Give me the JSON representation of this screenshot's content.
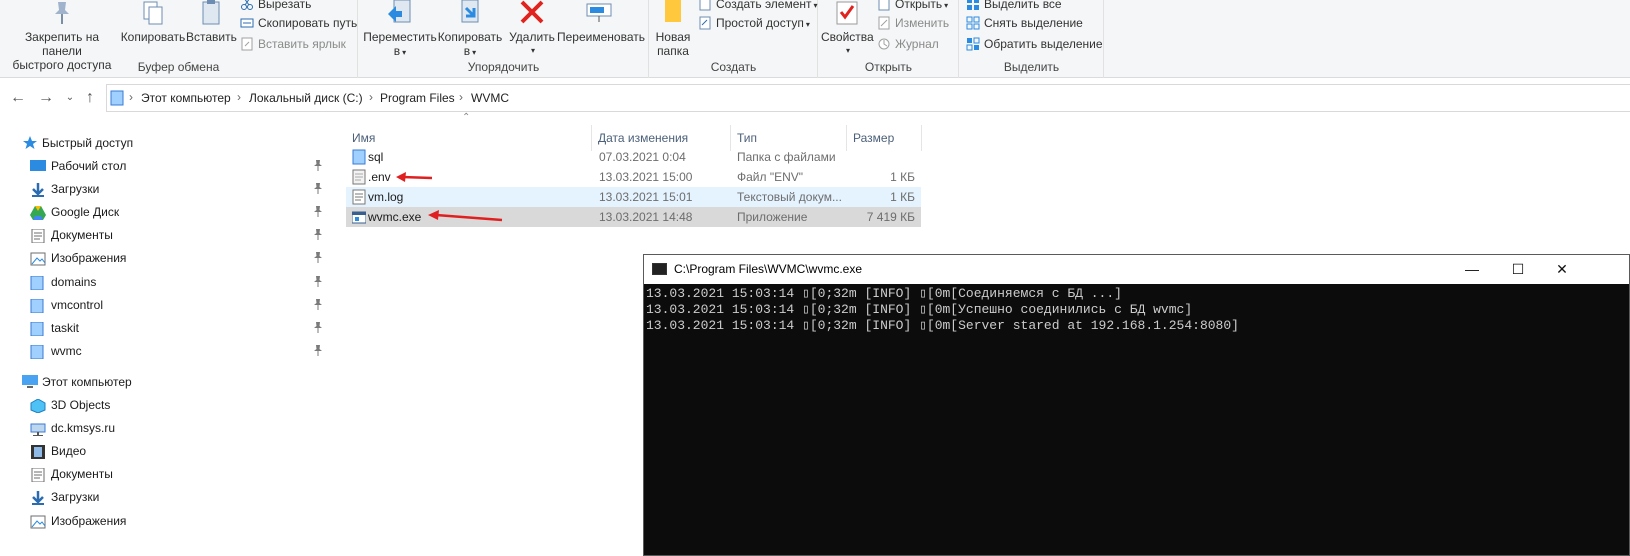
{
  "ribbon": {
    "clipboard": {
      "pin_quick_access": "Закрепить на панели\nбыстрого доступа",
      "pin_line1": "Закрепить на панели",
      "pin_line2": "быстрого доступа",
      "copy": "Копировать",
      "paste": "Вставить",
      "cut": "Вырезать",
      "copy_path": "Скопировать путь",
      "paste_shortcut": "Вставить ярлык",
      "group_label": "Буфер обмена"
    },
    "organize": {
      "move_line1": "Переместить",
      "move_line2": "в",
      "copy_line1": "Копировать",
      "copy_line2": "в",
      "delete": "Удалить",
      "rename": "Переименовать",
      "group_label": "Упорядочить"
    },
    "create": {
      "new_folder_line1": "Новая",
      "new_folder_line2": "папка",
      "new_item": "Создать элемент",
      "easy_access": "Простой доступ",
      "group_label": "Создать"
    },
    "open": {
      "properties": "Свойства",
      "open": "Открыть",
      "edit": "Изменить",
      "history": "Журнал",
      "group_label": "Открыть"
    },
    "select": {
      "select_all": "Выделить все",
      "select_none": "Снять выделение",
      "invert": "Обратить выделение",
      "group_label": "Выделить"
    }
  },
  "address": {
    "crumbs": [
      "Этот компьютер",
      "Локальный диск (C:)",
      "Program Files",
      "WVMC"
    ]
  },
  "nav": {
    "quick_access": "Быстрый доступ",
    "quick_items": [
      "Рабочий стол",
      "Загрузки",
      "Google Диск",
      "Документы",
      "Изображения",
      "domains",
      "vmcontrol",
      "taskit",
      "wvmc"
    ],
    "this_pc": "Этот компьютер",
    "pc_items": [
      "3D Objects",
      "dc.kmsys.ru",
      "Видео",
      "Документы",
      "Загрузки",
      "Изображения"
    ]
  },
  "files": {
    "columns": [
      "Имя",
      "Дата изменения",
      "Тип",
      "Размер"
    ],
    "rows": [
      {
        "name": "sql",
        "date": "07.03.2021 0:04",
        "type": "Папка с файлами",
        "size": ""
      },
      {
        "name": ".env",
        "date": "13.03.2021 15:00",
        "type": "Файл \"ENV\"",
        "size": "1 КБ"
      },
      {
        "name": "vm.log",
        "date": "13.03.2021 15:01",
        "type": "Текстовый докум...",
        "size": "1 КБ"
      },
      {
        "name": "wvmc.exe",
        "date": "13.03.2021 14:48",
        "type": "Приложение",
        "size": "7 419 КБ"
      }
    ]
  },
  "console": {
    "title": "C:\\Program Files\\WVMC\\wvmc.exe",
    "lines": [
      "13.03.2021 15:03:14 ▯[0;32m [INFO] ▯[0m[Соединяемся с БД ...]",
      "13.03.2021 15:03:14 ▯[0;32m [INFO] ▯[0m[Успешно соединились с БД wvmc]",
      "13.03.2021 15:03:14 ▯[0;32m [INFO] ▯[0m[Server stared at 192.168.1.254:8080]"
    ],
    "minimize": "—",
    "maximize": "☐",
    "close": "✕"
  },
  "colors": {
    "selected_row": "#cce8ff",
    "hover_row": "#e5f3ff",
    "annotation_arrow": "#e02020",
    "folder": "#ffc83d",
    "console_bg": "#0c0c0c"
  }
}
